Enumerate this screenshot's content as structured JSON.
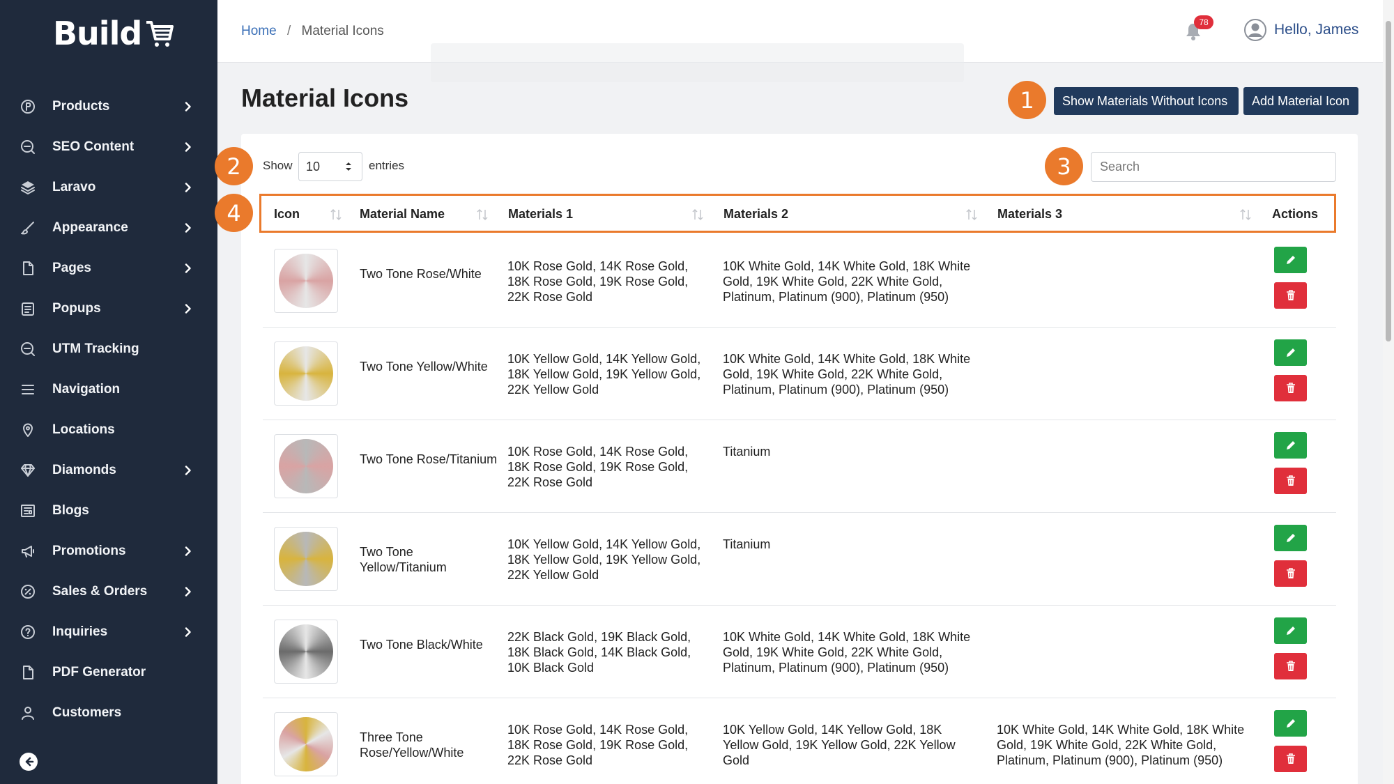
{
  "app": {
    "logo_text": "Build"
  },
  "sidebar": {
    "items": [
      {
        "label": "Products",
        "icon": "products-circle-p-icon",
        "has_children": true
      },
      {
        "label": "SEO Content",
        "icon": "seo-icon",
        "has_children": true
      },
      {
        "label": "Laravo",
        "icon": "layers-icon",
        "has_children": true
      },
      {
        "label": "Appearance",
        "icon": "brush-icon",
        "has_children": true
      },
      {
        "label": "Pages",
        "icon": "page-icon",
        "has_children": true
      },
      {
        "label": "Popups",
        "icon": "popup-icon",
        "has_children": true
      },
      {
        "label": "UTM Tracking",
        "icon": "seo-icon",
        "has_children": false
      },
      {
        "label": "Navigation",
        "icon": "menu-icon",
        "has_children": false
      },
      {
        "label": "Locations",
        "icon": "location-pin-icon",
        "has_children": false
      },
      {
        "label": "Diamonds",
        "icon": "diamond-icon",
        "has_children": true
      },
      {
        "label": "Blogs",
        "icon": "blog-icon",
        "has_children": false
      },
      {
        "label": "Promotions",
        "icon": "megaphone-icon",
        "has_children": true
      },
      {
        "label": "Sales & Orders",
        "icon": "percent-badge-icon",
        "has_children": true
      },
      {
        "label": "Inquiries",
        "icon": "question-icon",
        "has_children": true
      },
      {
        "label": "PDF Generator",
        "icon": "page-icon",
        "has_children": false
      },
      {
        "label": "Customers",
        "icon": "user-icon",
        "has_children": false
      }
    ]
  },
  "header": {
    "breadcrumb": {
      "home": "Home",
      "separator": "/",
      "current": "Material Icons"
    },
    "notifications_count": "78",
    "greeting": "Hello, James"
  },
  "main": {
    "title": "Material Icons",
    "buttons": {
      "show_without_icons": "Show Materials Without Icons",
      "add_icon": "Add Material Icon"
    },
    "markers": [
      "1",
      "2",
      "3",
      "4"
    ],
    "show_label": "Show",
    "page_size": "10",
    "entries_label": "entries",
    "search_placeholder": "Search",
    "columns": [
      "Icon",
      "Material Name",
      "Materials 1",
      "Materials 2",
      "Materials 3",
      "Actions"
    ],
    "rows": [
      {
        "name": "Two Tone Rose/White",
        "m1": "10K Rose Gold, 14K Rose Gold, 18K Rose Gold, 19K Rose Gold, 22K Rose Gold",
        "m2": "10K White Gold, 14K White Gold, 18K White Gold, 19K White Gold, 22K White Gold, Platinum, Platinum (900), Platinum (950)",
        "m3": "",
        "colors": [
          "#d9a3a3",
          "#e6e6e6"
        ]
      },
      {
        "name": "Two Tone Yellow/White",
        "m1": "10K Yellow Gold, 14K Yellow Gold, 18K Yellow Gold, 19K Yellow Gold, 22K Yellow Gold",
        "m2": "10K White Gold, 14K White Gold, 18K White Gold, 19K White Gold, 22K White Gold, Platinum, Platinum (900), Platinum (950)",
        "m3": "",
        "colors": [
          "#d8b43e",
          "#e6e6e6"
        ]
      },
      {
        "name": "Two Tone Rose/Titanium",
        "m1": "10K Rose Gold, 14K Rose Gold, 18K Rose Gold, 19K Rose Gold, 22K Rose Gold",
        "m2": "Titanium",
        "m3": "",
        "colors": [
          "#d9a3a3",
          "#b8b8b8"
        ]
      },
      {
        "name": "Two Tone Yellow/Titanium",
        "m1": "10K Yellow Gold, 14K Yellow Gold, 18K Yellow Gold, 19K Yellow Gold, 22K Yellow Gold",
        "m2": "Titanium",
        "m3": "",
        "colors": [
          "#d8b43e",
          "#b8b8b8"
        ]
      },
      {
        "name": "Two Tone Black/White",
        "m1": "22K Black Gold, 19K Black Gold, 18K Black Gold, 14K Black Gold, 10K Black Gold",
        "m2": "10K White Gold, 14K White Gold, 18K White Gold, 19K White Gold, 22K White Gold, Platinum, Platinum (900), Platinum (950)",
        "m3": "",
        "colors": [
          "#6b6b6b",
          "#e6e6e6"
        ]
      },
      {
        "name": "Three Tone Rose/Yellow/White",
        "m1": "10K Rose Gold, 14K Rose Gold, 18K Rose Gold, 19K Rose Gold, 22K Rose Gold",
        "m2": "10K Yellow Gold, 14K Yellow Gold, 18K Yellow Gold, 19K Yellow Gold, 22K Yellow Gold",
        "m3": "10K White Gold, 14K White Gold, 18K White Gold, 19K White Gold, 22K White Gold, Platinum, Platinum (900), Platinum (950)",
        "colors": [
          "#d9a3a3",
          "#d8b43e",
          "#e6e6e6"
        ]
      }
    ]
  },
  "theme": {
    "sidebar_bg": "#1f2a3c",
    "accent_orange": "#ea7a2c",
    "button_dark": "#213a5c",
    "edit_green": "#22a447",
    "delete_red": "#e02f3b",
    "link_blue": "#3a6fb7"
  }
}
